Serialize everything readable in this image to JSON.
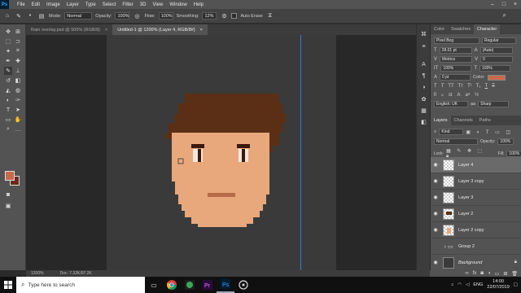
{
  "app": {
    "name": "Adobe Photoshop",
    "logo_text": "Ps"
  },
  "menu": [
    "File",
    "Edit",
    "Image",
    "Layer",
    "Type",
    "Select",
    "Filter",
    "3D",
    "View",
    "Window",
    "Help"
  ],
  "options_bar": {
    "mode_label": "Mode:",
    "mode_value": "Normal",
    "opacity_label": "Opacity:",
    "opacity_value": "100%",
    "flow_label": "Flow:",
    "flow_value": "100%",
    "smoothing_label": "Smoothing:",
    "smoothing_value": "12%",
    "auto_erase_label": "Auto Erase"
  },
  "doc_tabs": [
    {
      "label": "Rain overlay.psd @ 500% (RGB/8)",
      "close": "×",
      "active": false
    },
    {
      "label": "Untitled-1 @ 1200% (Layer 4, RGB/8#)",
      "close": "×",
      "active": true
    }
  ],
  "status_bar": {
    "zoom": "1200%",
    "doc": "Doc: 7.32K/97.2K"
  },
  "right_panel": {
    "top_tabs": [
      "Color",
      "Swatches",
      "Character"
    ],
    "character": {
      "font_family": "Pixel Bog",
      "font_style": "Regular",
      "font_size": "28.01 pt",
      "leading": "(Auto)",
      "kerning": "Metrics",
      "tracking": "0",
      "vertical_scale": "100%",
      "horizontal_scale": "100%",
      "baseline_shift": "0 pt",
      "color_label": "Color:",
      "color_value": "#c76a4c",
      "language": "English: UK",
      "antialias": "Sharp"
    },
    "layer_tabs": [
      "Layers",
      "Channels",
      "Paths"
    ],
    "kind_label": "Kind",
    "blend_mode": "Normal",
    "opacity_label": "Opacity:",
    "opacity_value": "100%",
    "lock_label": "Lock:",
    "fill_label": "Fill:",
    "fill_value": "100%",
    "layers": [
      {
        "name": "Layer 4",
        "selected": true,
        "visible": true,
        "type": "pixel"
      },
      {
        "name": "Layer 3 copy",
        "selected": false,
        "visible": true,
        "type": "pixel"
      },
      {
        "name": "Layer 3",
        "selected": false,
        "visible": true,
        "type": "pixel"
      },
      {
        "name": "Layer 2",
        "selected": false,
        "visible": true,
        "type": "hair"
      },
      {
        "name": "Layer 2 copy",
        "selected": false,
        "visible": true,
        "type": "face"
      },
      {
        "name": "Group 2",
        "selected": false,
        "visible": false,
        "type": "group"
      },
      {
        "name": "Background",
        "selected": false,
        "visible": true,
        "type": "background"
      }
    ]
  },
  "canvas": {
    "colors": {
      "skin": "#e8a87c",
      "hair": "#5b2f15",
      "eye_white": "#f5e7dc",
      "pupil": "#3b1a0c",
      "mouth": "#b56a48",
      "guide": "#3d7cd8"
    }
  },
  "taskbar": {
    "search_placeholder": "Type here to search",
    "lang": "ENG",
    "time": "14:00",
    "date": "22/07/2019"
  },
  "colors": {
    "foreground": "#c76a4c",
    "background": "#6b2a1a"
  }
}
